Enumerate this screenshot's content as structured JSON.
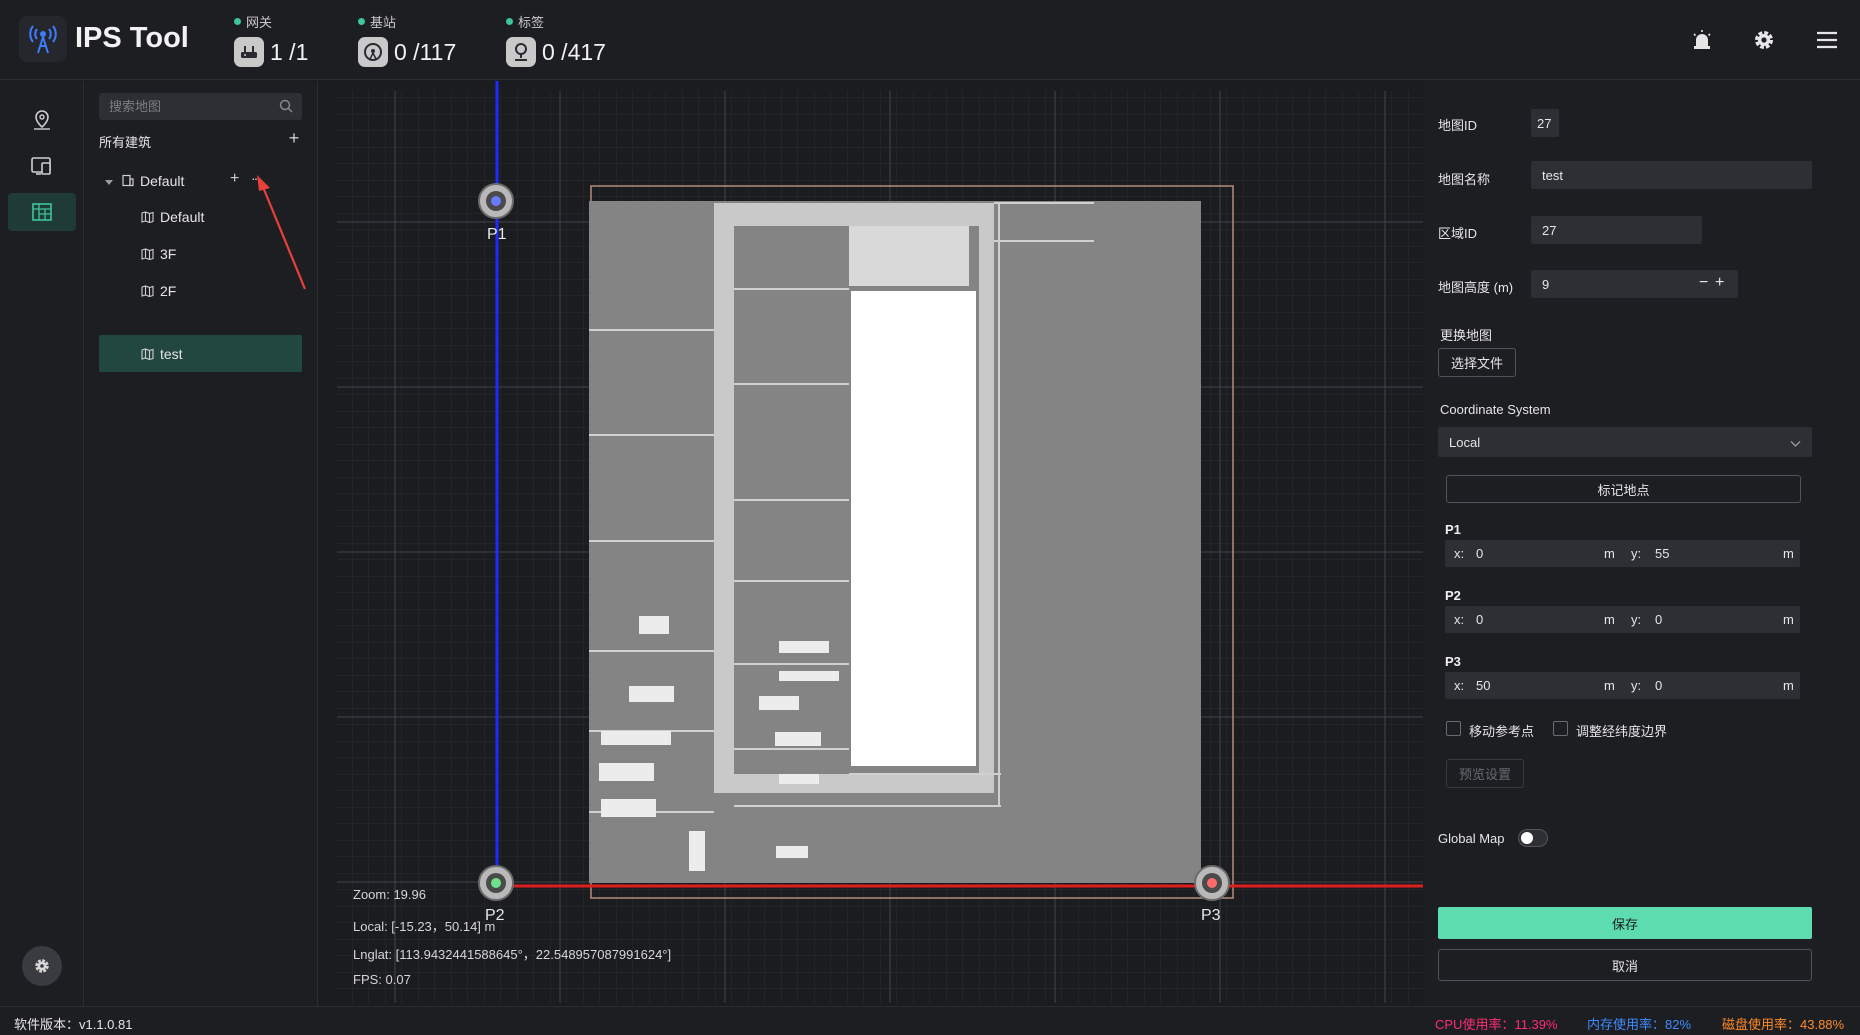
{
  "header": {
    "app_title": "IPS Tool",
    "gateway": {
      "label": "网关",
      "value": "1 /1",
      "icon": "router-icon"
    },
    "base_station": {
      "label": "基站",
      "value": "0 /117",
      "icon": "antenna-icon"
    },
    "tag": {
      "label": "标签",
      "value": "0 /417",
      "icon": "location-tag-icon"
    },
    "right_icons": [
      "alarm-icon",
      "gear-icon",
      "menu-icon"
    ]
  },
  "rail": {
    "items": [
      "map-pin-icon",
      "devices-icon",
      "building-map-icon"
    ],
    "active": 2,
    "bottom_icon": "settings-icon"
  },
  "sidebar": {
    "search_placeholder": "搜索地图",
    "all_buildings": "所有建筑",
    "add": "+",
    "building": {
      "name": "Default",
      "add": "+",
      "more": "···"
    },
    "maps": [
      {
        "name": "Default"
      },
      {
        "name": "3F"
      },
      {
        "name": "2F"
      },
      {
        "name": "test",
        "selected": true
      }
    ]
  },
  "canvas": {
    "zoom": "Zoom:  19.96",
    "local": "Local:  [-15.23，50.14] m",
    "lnglat": "Lnglat:  [113.9432441588645°，22.548957087991624°]",
    "fps": "FPS:  0.07",
    "points": [
      "P1",
      "P2",
      "P3"
    ],
    "axis_colors": {
      "y": "#1b2cff",
      "x": "#e01e1e"
    }
  },
  "panel": {
    "map_id_label": "地图ID",
    "map_id": "27",
    "map_name_label": "地图名称",
    "map_name": "test",
    "area_id_label": "区域ID",
    "area_id": "27",
    "map_height_label": "地图高度 (m)",
    "map_height": "9",
    "minus": "−",
    "plus": "+",
    "replace_map_label": "更换地图",
    "choose_file": "选择文件",
    "coord_system_label": "Coordinate System",
    "coord_system": "Local",
    "mark_location": "标记地点",
    "p1": {
      "label": "P1",
      "x": "0",
      "y": "55"
    },
    "p2": {
      "label": "P2",
      "x": "0",
      "y": "0"
    },
    "p3": {
      "label": "P3",
      "x": "50",
      "y": "0"
    },
    "x_prefix": "x:",
    "y_prefix": "y:",
    "unit": "m",
    "move_ref_point": "移动参考点",
    "adjust_bounds": "调整经纬度边界",
    "preview_settings": "预览设置",
    "global_map_label": "Global Map",
    "save": "保存",
    "cancel": "取消",
    "save_color": "#5ddcb0"
  },
  "footer": {
    "version": "软件版本：v1.1.0.81",
    "cpu": "CPU使用率：11.39%",
    "memory": "内存使用率：82%",
    "disk": "磁盘使用率：43.88%",
    "cpu_color": "#ff2d6f",
    "memory_color": "#3d8cff",
    "disk_color": "#ff8a2a"
  }
}
